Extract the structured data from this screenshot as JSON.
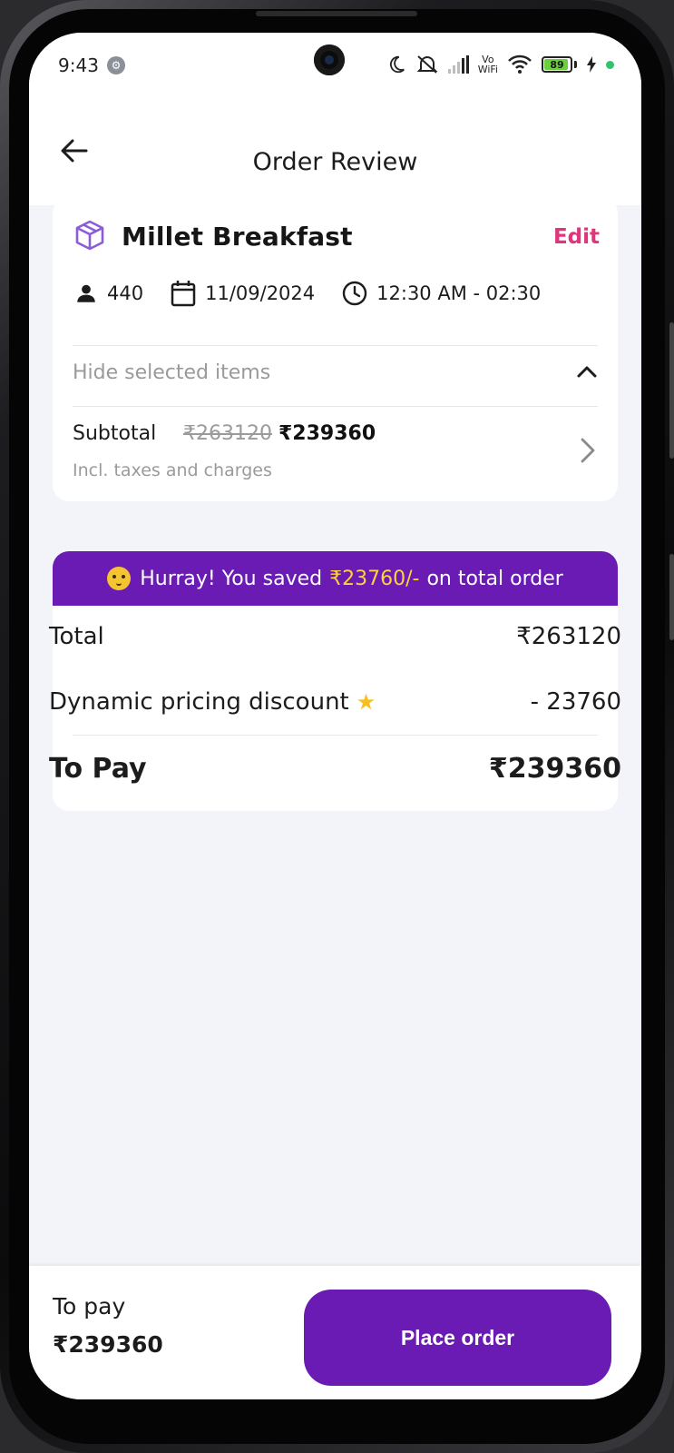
{
  "status_bar": {
    "time": "9:43",
    "vowifi_top": "Vo",
    "vowifi_bottom": "WiFi",
    "battery": "89"
  },
  "header": {
    "title": "Order Review"
  },
  "order": {
    "title": "Millet Breakfast",
    "edit_label": "Edit",
    "guests": "440",
    "date": "11/09/2024",
    "time_slot": "12:30 AM - 02:30",
    "hide_items_label": "Hide selected items",
    "subtotal_label": "Subtotal",
    "subtotal_original": "₹263120",
    "subtotal_discounted": "₹239360",
    "taxes_note": "Incl. taxes and charges"
  },
  "savings": {
    "prefix": "Hurray! You saved",
    "amount": "₹23760/-",
    "suffix": "on total order"
  },
  "bill": {
    "total_label": "Total",
    "total_value": "₹263120",
    "discount_label": "Dynamic pricing discount",
    "discount_value": "- 23760",
    "to_pay_label": "To Pay",
    "to_pay_value": "₹239360"
  },
  "footer": {
    "to_pay_label": "To pay",
    "to_pay_amount": "₹239360",
    "place_order_label": "Place order"
  },
  "colors": {
    "accent_purple": "#6a1bb3",
    "edit_pink": "#e0357d",
    "savings_yellow": "#ffd13b",
    "background": "#f3f4f9"
  },
  "icons": [
    "back-arrow-icon",
    "package-icon",
    "person-icon",
    "calendar-icon",
    "clock-icon",
    "chevron-up-icon",
    "chevron-right-icon",
    "star-icon",
    "party-emoji-icon",
    "moon-icon",
    "mute-icon",
    "signal-icon",
    "wifi-icon",
    "battery-icon",
    "charging-icon"
  ]
}
